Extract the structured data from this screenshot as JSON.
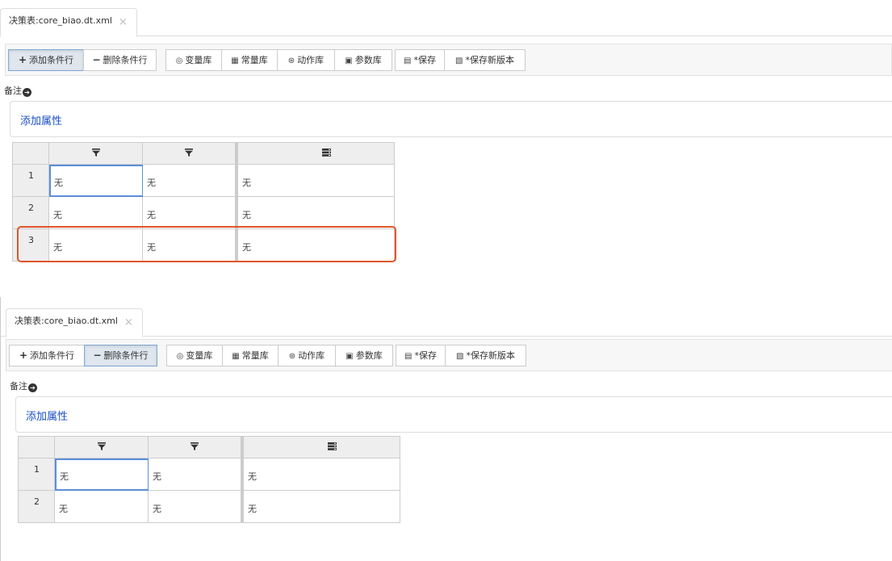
{
  "panels": [
    {
      "tab": {
        "title": "决策表:core_biao.dt.xml",
        "close": "×"
      },
      "toolbar": {
        "add_row": "添加条件行",
        "delete_row": "删除条件行",
        "variable_lib": "变量库",
        "constant_lib": "常量库",
        "action_lib": "动作库",
        "parameter_lib": "参数库",
        "save": "*保存",
        "save_new_version": "*保存新版本",
        "active_button": "add_row"
      },
      "remark_label": "备注",
      "add_attribute": "添加属性",
      "table": {
        "columns": [
          "condition-filter",
          "condition-filter",
          "action"
        ],
        "rows": [
          {
            "num": "1",
            "cells": [
              "无",
              "无",
              "无"
            ]
          },
          {
            "num": "2",
            "cells": [
              "无",
              "无",
              "无"
            ]
          },
          {
            "num": "3",
            "cells": [
              "无",
              "无",
              "无"
            ]
          }
        ],
        "highlighted_row": "3"
      }
    },
    {
      "tab": {
        "title": "决策表:core_biao.dt.xml",
        "close": "×"
      },
      "toolbar": {
        "add_row": "添加条件行",
        "delete_row": "删除条件行",
        "variable_lib": "变量库",
        "constant_lib": "常量库",
        "action_lib": "动作库",
        "parameter_lib": "参数库",
        "save": "*保存",
        "save_new_version": "*保存新版本",
        "active_button": "delete_row"
      },
      "remark_label": "备注",
      "add_attribute": "添加属性",
      "table": {
        "columns": [
          "condition-filter",
          "condition-filter",
          "action"
        ],
        "rows": [
          {
            "num": "1",
            "cells": [
              "无",
              "无",
              "无"
            ]
          },
          {
            "num": "2",
            "cells": [
              "无",
              "无",
              "无"
            ]
          }
        ]
      }
    }
  ],
  "colors": {
    "highlight": "#e0552b",
    "link": "#1a4fc4",
    "selected_cell": "#5b8fd8"
  }
}
